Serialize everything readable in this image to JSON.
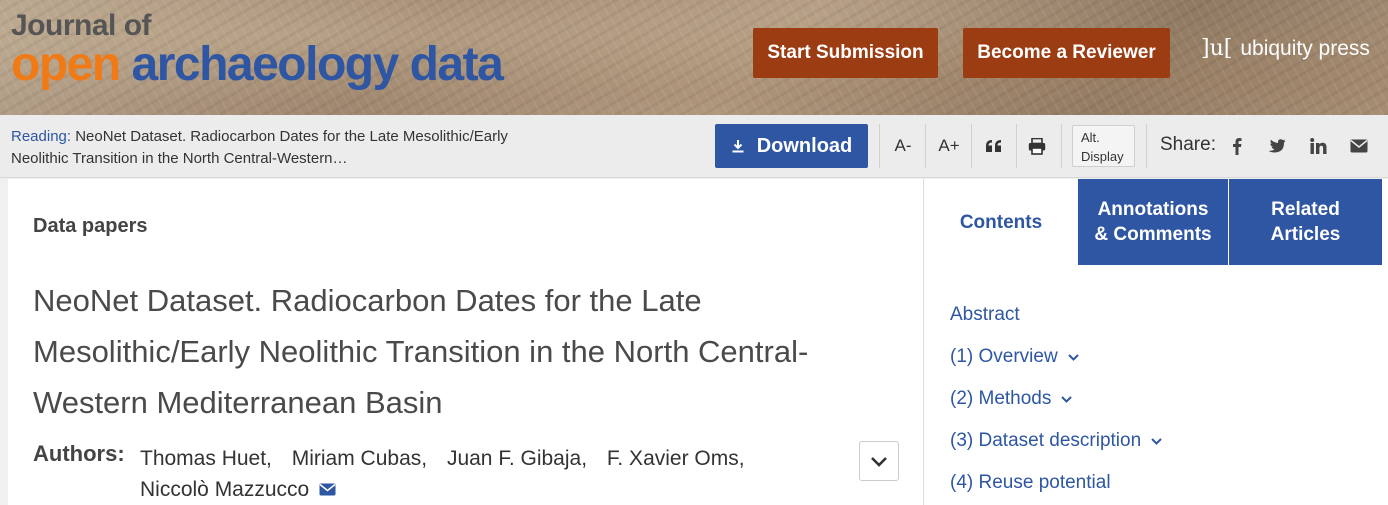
{
  "header": {
    "logo_line1": "Journal of",
    "logo_word1": "open",
    "logo_word2": "archaeology data",
    "start_submission": "Start Submission",
    "become_reviewer": "Become a Reviewer",
    "publisher_mark": "]u[",
    "publisher_name": "ubiquity press"
  },
  "toolbar": {
    "reading_label": "Reading:",
    "reading_title": "NeoNet Dataset. Radiocarbon Dates for the Late Mesolithic/Early Neolithic Transition in the North Central-Western…",
    "download": "Download",
    "font_smaller": "A-",
    "font_larger": "A+",
    "cite_icon": "quote-icon",
    "print_icon": "print-icon",
    "alt_display_line1": "Alt.",
    "alt_display_line2": "Display",
    "share_label": "Share:",
    "share_icons": [
      "facebook-icon",
      "twitter-icon",
      "linkedin-icon",
      "email-icon"
    ]
  },
  "article": {
    "section": "Data papers",
    "title": "NeoNet Dataset. Radiocarbon Dates for the Late Mesolithic/Early Neolithic Transition in the North Central-Western Mediterranean Basin",
    "authors_label": "Authors:",
    "authors": [
      "Thomas Huet,",
      "Miriam Cubas,",
      "Juan F. Gibaja,",
      "F. Xavier Oms,",
      "Niccolò Mazzucco"
    ]
  },
  "sidebar": {
    "tabs": {
      "contents": "Contents",
      "annotations_1": "Annotations",
      "annotations_2": "& Comments",
      "related_1": "Related",
      "related_2": "Articles"
    },
    "toc": [
      "Abstract",
      "(1) Overview",
      "(2) Methods",
      "(3) Dataset description",
      "(4) Reuse potential"
    ],
    "toc_expandable": [
      false,
      true,
      true,
      true,
      false
    ]
  },
  "colors": {
    "brand_blue": "#2e56a3",
    "brand_orange": "#f07a16",
    "header_button": "#9b3c12"
  }
}
